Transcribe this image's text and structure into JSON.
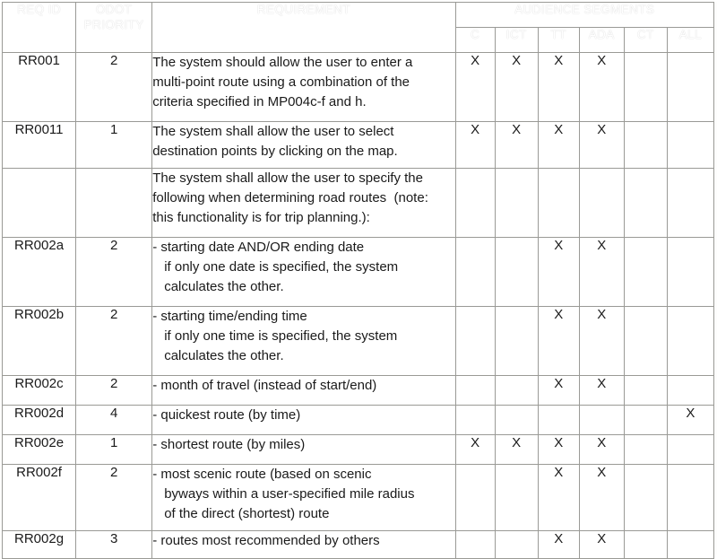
{
  "table": {
    "headers": {
      "req_id": "REQ ID",
      "odot_priority_line1": "ODOT",
      "odot_priority_line2": "PRIORITY",
      "requirement": "REQUIREMENT",
      "audience_segments": "AUDIENCE SEGMENTS",
      "segments": [
        "C",
        "ICT",
        "TT",
        "ADA",
        "CT",
        "ALL"
      ]
    },
    "mark": "X",
    "rows": [
      {
        "req_id": "RR001",
        "priority": "2",
        "requirement_lines": [
          "The system should allow the user to enter a",
          "multi-point route using a combination of the",
          "criteria specified in MP004c-f and h."
        ],
        "indent_from": 99,
        "segments": [
          "X",
          "X",
          "X",
          "X",
          "",
          ""
        ],
        "row_class": "h-3line"
      },
      {
        "req_id": "RR0011",
        "priority": "1",
        "requirement_lines": [
          "The system shall allow the user to select",
          "destination points by clicking on the map."
        ],
        "indent_from": 99,
        "segments": [
          "X",
          "X",
          "X",
          "X",
          "",
          ""
        ],
        "row_class": "h-2line"
      },
      {
        "req_id": "",
        "priority": "",
        "requirement_lines": [
          "The system shall allow the user to specify the",
          "following when determining road routes  (note:",
          "this functionality is for trip planning.):"
        ],
        "indent_from": 99,
        "segments": [
          "",
          "",
          "",
          "",
          "",
          ""
        ],
        "row_class": "h-3line"
      },
      {
        "req_id": "RR002a",
        "priority": "2",
        "requirement_lines": [
          "- starting date AND/OR ending date",
          "if only one date is specified, the system",
          "calculates the other."
        ],
        "indent_from": 1,
        "segments": [
          "",
          "",
          "X",
          "X",
          "",
          ""
        ],
        "row_class": "h-3line"
      },
      {
        "req_id": "RR002b",
        "priority": "2",
        "requirement_lines": [
          "- starting time/ending time",
          "if only one time is specified, the system",
          "calculates the other."
        ],
        "indent_from": 1,
        "segments": [
          "",
          "",
          "X",
          "X",
          "",
          ""
        ],
        "row_class": "h-3line"
      },
      {
        "req_id": "RR002c",
        "priority": "2",
        "requirement_lines": [
          "- month of travel (instead of start/end)"
        ],
        "indent_from": 99,
        "segments": [
          "",
          "",
          "X",
          "X",
          "",
          ""
        ],
        "row_class": "h-1line"
      },
      {
        "req_id": "RR002d",
        "priority": "4",
        "requirement_lines": [
          "- quickest route (by time)"
        ],
        "indent_from": 99,
        "segments": [
          "",
          "",
          "",
          "",
          "",
          "X"
        ],
        "row_class": "h-1line"
      },
      {
        "req_id": "RR002e",
        "priority": "1",
        "requirement_lines": [
          "- shortest route (by miles)"
        ],
        "indent_from": 99,
        "segments": [
          "X",
          "X",
          "X",
          "X",
          "",
          ""
        ],
        "row_class": "h-1line"
      },
      {
        "req_id": "RR002f",
        "priority": "2",
        "requirement_lines": [
          "- most scenic route (based on scenic",
          "byways within a user-specified mile radius",
          "of the direct (shortest) route"
        ],
        "indent_from": 1,
        "segments": [
          "",
          "",
          "X",
          "X",
          "",
          ""
        ],
        "row_class": "h-4line"
      },
      {
        "req_id": "RR002g",
        "priority": "3",
        "requirement_lines": [
          "- routes most recommended by others"
        ],
        "indent_from": 99,
        "segments": [
          "",
          "",
          "X",
          "X",
          "",
          ""
        ],
        "row_class": "h-last"
      }
    ]
  }
}
